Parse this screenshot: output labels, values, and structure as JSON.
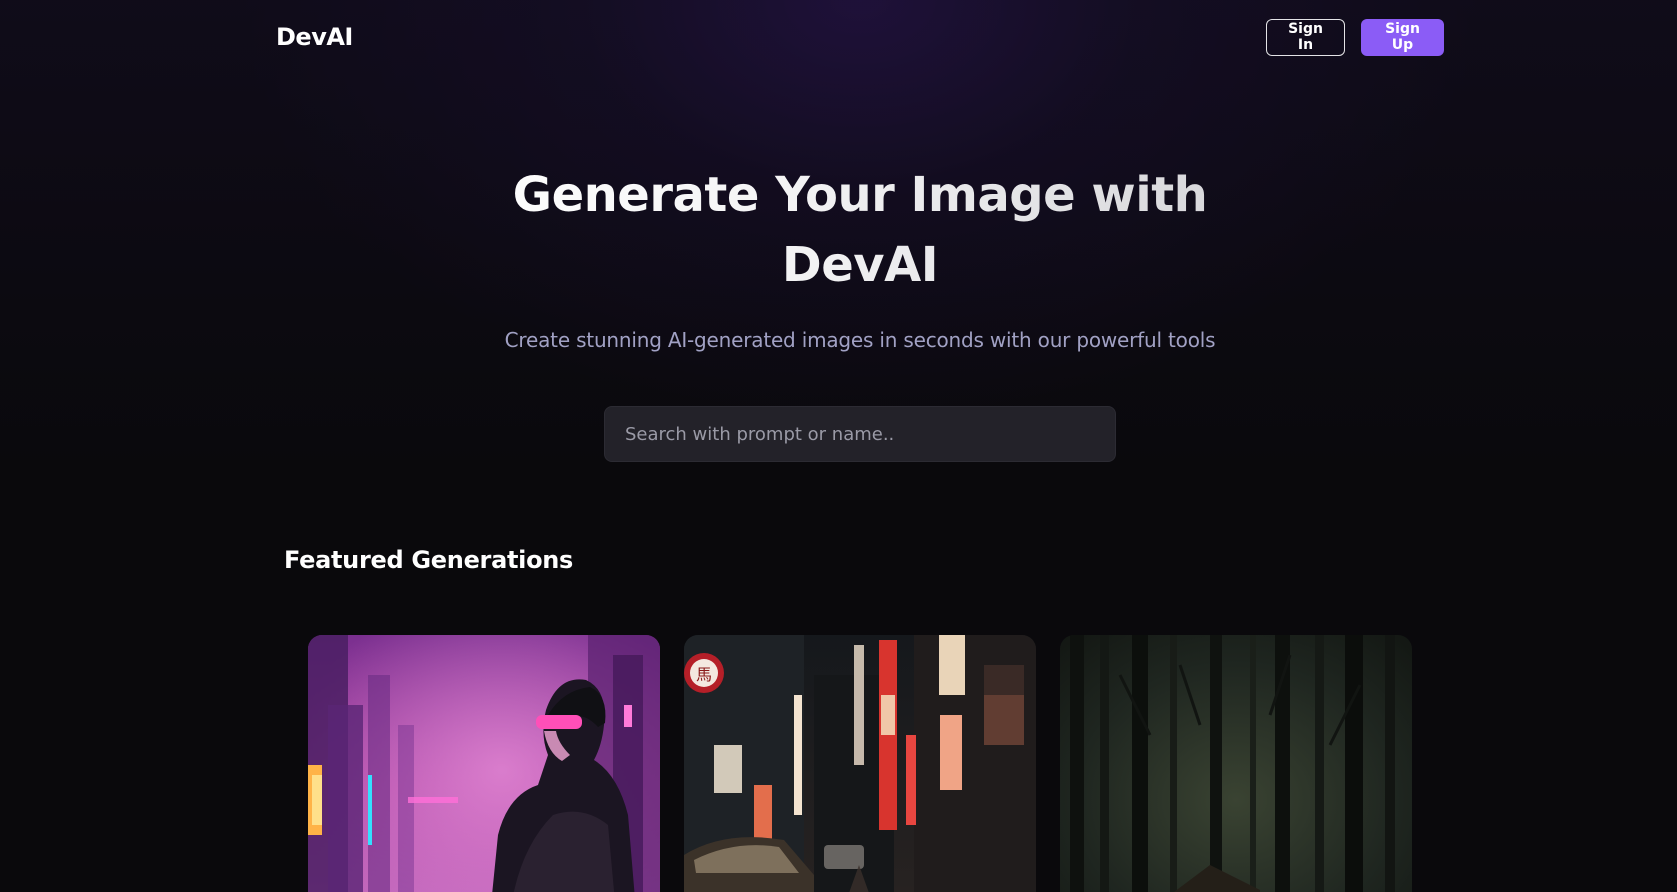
{
  "navbar": {
    "brand": "DevAI",
    "sign_in_label": "Sign In",
    "sign_up_label": "Sign Up"
  },
  "hero": {
    "title_line1": "Generate Your Image with",
    "title_line2": "DevAI",
    "subtitle": "Create stunning AI-generated images in seconds with our powerful tools"
  },
  "search": {
    "placeholder": "Search with prompt or name.."
  },
  "featured": {
    "title": "Featured Generations"
  },
  "colors": {
    "accent": "#8b5cf6",
    "background": "#0a090c",
    "search_bg": "#232229"
  }
}
